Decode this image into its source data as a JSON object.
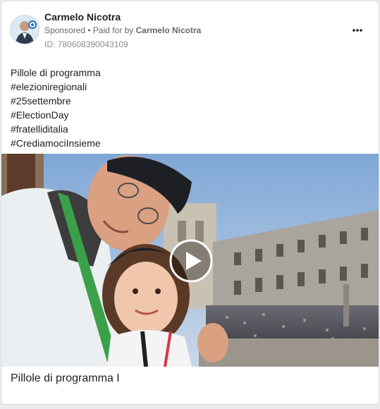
{
  "ad": {
    "advertiser": "Carmelo Nicotra",
    "sponsored": "Sponsored",
    "separator": " • ",
    "paid_for_prefix": "Paid for by ",
    "paid_for_name": "Carmelo Nicotra",
    "id_label": "ID: 780608390043109",
    "more_icon": "ellipsis-icon"
  },
  "post": {
    "lines": [
      "Pillole di programma",
      "#elezioniregionali",
      "#25settembre",
      "#ElectionDay",
      "#fratelliditalia",
      "#CrediamociInsieme"
    ]
  },
  "media": {
    "type": "video",
    "play_icon": "play-icon"
  },
  "caption": "Pillole di programma I",
  "colors": {
    "text": "#1c1e21",
    "secondary": "#65676b",
    "border": "#dadde1"
  }
}
